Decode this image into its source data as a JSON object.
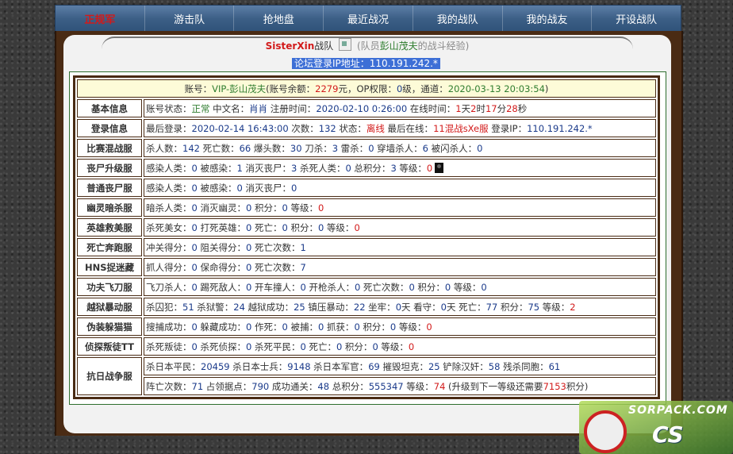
{
  "nav": [
    {
      "label": "正规军",
      "active": true
    },
    {
      "label": "游击队"
    },
    {
      "label": "抢地盘"
    },
    {
      "label": "最近战况"
    },
    {
      "label": "我的战队"
    },
    {
      "label": "我的战友"
    },
    {
      "label": "开设战队"
    }
  ],
  "title": {
    "name": "SisterXin",
    "team": "战队",
    "prefix": "(队员",
    "member": "彭山茂夫",
    "suffix": "的战斗经验)"
  },
  "forum_ip": "论坛登录IP地址：110.191.242.*",
  "account": {
    "l1": "账号：",
    "v1": "VIP-彭山茂夫",
    "l2": "(账号余额：",
    "v2": "2279",
    "l3": "元，OP权限：",
    "v3": "0",
    "l4": "级，通道：",
    "v4": "2020-03-13 20:03:54",
    "l5": ")"
  },
  "rows": {
    "basic": {
      "cat": "基本信息",
      "a": "账号状态：",
      "b": "正常",
      "c": " 中文名：",
      "d": "肖肖",
      "e": " 注册时间：",
      "f": "2020-02-10 0:26:00",
      "g": " 在线时间：",
      "h": "1",
      "i": "天",
      "j": "2",
      "k": "时",
      "l": "17",
      "m": "分",
      "n": "28",
      "o": "秒"
    },
    "login": {
      "cat": "登录信息",
      "a": "最后登录：",
      "b": "2020-02-14 16:43:00",
      "c": " 次数：",
      "d": "132",
      "e": " 状态：",
      "f": "离线",
      "g": " 最后在线：",
      "h": "11混战sXe服",
      "i": " 登录IP：",
      "j": "110.191.242.*"
    },
    "mix": {
      "cat": "比赛混战服",
      "a": "杀人数：",
      "b": "142",
      "c": " 死亡数：",
      "d": "66",
      "e": " 爆头数：",
      "f": "30",
      "g": " 刀杀：",
      "h": "3",
      "i": " 雷杀：",
      "j": "0",
      "k": " 穿墙杀人：",
      "l": "6",
      "m": " 被闪杀人：",
      "n": "0"
    },
    "zombie_up": {
      "cat": "丧尸升级服",
      "a": "感染人类：",
      "b": "0",
      "c": " 被感染：",
      "d": "1",
      "e": " 消灭丧尸：",
      "f": "3",
      "g": " 杀死人类：",
      "h": "0",
      "i": " 总积分：",
      "j": "3",
      "k": " 等级：",
      "l": "0"
    },
    "zombie": {
      "cat": "普通丧尸服",
      "a": "感染人类：",
      "b": "0",
      "c": " 被感染：",
      "d": "0",
      "e": " 消灭丧尸：",
      "f": "0"
    },
    "ghost": {
      "cat": "幽灵暗杀服",
      "a": "暗杀人类：",
      "b": "0",
      "c": " 消灭幽灵：",
      "d": "0",
      "e": " 积分：",
      "f": "0",
      "g": " 等级：",
      "h": "0"
    },
    "hero": {
      "cat": "英雄救美服",
      "a": "杀死美女：",
      "b": "0",
      "c": " 打死英雄：",
      "d": "0",
      "e": " 死亡：",
      "f": "0",
      "g": " 积分：",
      "h": "0",
      "i": " 等级：",
      "j": "0"
    },
    "death": {
      "cat": "死亡奔跑服",
      "a": "冲关得分：",
      "b": "0",
      "c": " 阻关得分：",
      "d": "0",
      "e": " 死亡次数：",
      "f": "1"
    },
    "hns": {
      "cat": "HNS捉迷藏",
      "a": "抓人得分：",
      "b": "0",
      "c": " 保命得分：",
      "d": "0",
      "e": " 死亡次数：",
      "f": "7"
    },
    "kungfu": {
      "cat": "功夫飞刀服",
      "a": "飞刀杀人：",
      "b": "0",
      "c": " 踢死敌人：",
      "d": "0",
      "e": " 开车撞人：",
      "f": "0",
      "g": " 开枪杀人：",
      "h": "0",
      "i": " 死亡次数：",
      "j": "0",
      "k": " 积分：",
      "l": "0",
      "m": " 等级：",
      "n": "0"
    },
    "jail": {
      "cat": "越狱暴动服",
      "a": "杀囚犯：",
      "b": "51",
      "c": " 杀狱警：",
      "d": "24",
      "e": " 越狱成功：",
      "f": "25",
      "g": " 镇压暴动：",
      "h": "22",
      "i": " 坐牢：",
      "j": "0",
      "k": "天",
      "l": " 看守：",
      "m": "0",
      "n": "天",
      "o": " 死亡：",
      "p": "77",
      "q": " 积分：",
      "r": "75",
      "s": " 等级：",
      "t": "2"
    },
    "cat": {
      "cat": "伪装躲猫猫",
      "a": "搜捕成功：",
      "b": "0",
      "c": " 躲藏成功：",
      "d": "0",
      "e": " 作死：",
      "f": "0",
      "g": " 被捕：",
      "h": "0",
      "i": " 抓获：",
      "j": "0",
      "k": " 积分：",
      "l": "0",
      "m": " 等级：",
      "n": "0"
    },
    "ttt": {
      "cat": "侦探叛徒TT",
      "a": "杀死叛徒：",
      "b": "0",
      "c": " 杀死侦探：",
      "d": "0",
      "e": " 杀死平民：",
      "f": "0",
      "g": " 死亡：",
      "h": "0",
      "i": " 积分：",
      "j": "0",
      "k": " 等级：",
      "l": "0"
    },
    "war": {
      "cat": "抗日战争服",
      "r1": {
        "a": "杀日本平民：",
        "b": "20459",
        "c": " 杀日本士兵：",
        "d": "9148",
        "e": " 杀日本军官：",
        "f": "69",
        "g": " 摧毁坦克：",
        "h": "25",
        "i": " 铲除汉奸：",
        "j": "58",
        "k": " 残杀同胞：",
        "l": "61"
      },
      "r2": {
        "a": "阵亡次数：",
        "b": "71",
        "c": " 占领据点：",
        "d": "790",
        "e": " 成功通关：",
        "f": "48",
        "g": " 总积分：",
        "h": "555347",
        "i": " 等级：",
        "j": "74",
        "k": " (升级到下一等级还需要",
        "l": "7153",
        "m": "积分)"
      }
    }
  },
  "logo": {
    "line1": "SORPACK.COM",
    "line2": "CS"
  }
}
